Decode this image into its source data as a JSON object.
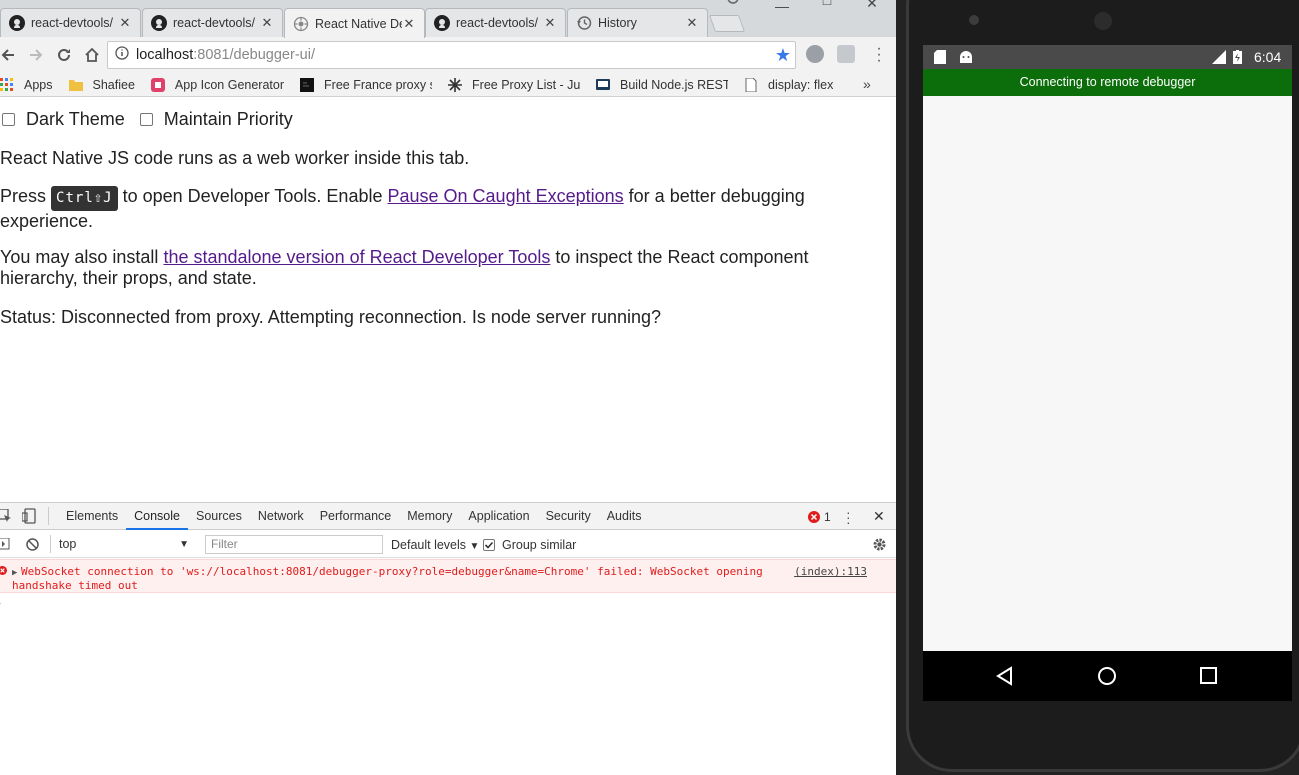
{
  "browser": {
    "tabs": [
      {
        "title": "react-devtools/",
        "icon": "github-icon"
      },
      {
        "title": "react-devtools/",
        "icon": "github-icon"
      },
      {
        "title": "React Native De",
        "icon": "react-native-icon"
      },
      {
        "title": "react-devtools/",
        "icon": "github-icon"
      },
      {
        "title": "History",
        "icon": "history-icon"
      }
    ],
    "active_tab": 2,
    "close_glyph": "✕",
    "url_host": "localhost",
    "url_path": ":8081/debugger-ui/",
    "bookmarks": [
      {
        "label": "Apps",
        "icon": "apps-grid-icon"
      },
      {
        "label": "Shafiee",
        "icon": "folder-icon"
      },
      {
        "label": "App Icon Generator",
        "icon": "app-icon-generator-icon"
      },
      {
        "label": "Free France proxy se",
        "icon": "terminal-icon"
      },
      {
        "label": "Free Proxy List - Just",
        "icon": "proxy-list-icon"
      },
      {
        "label": "Build Node.js RESTfu",
        "icon": "codementor-icon"
      },
      {
        "label": "display: flex",
        "icon": "page-icon"
      }
    ],
    "bookmarks_more": "»"
  },
  "page": {
    "dark_theme_label": "Dark Theme",
    "maintain_priority_label": "Maintain Priority",
    "intro": "React Native JS code runs as a web worker inside this tab.",
    "press_prefix": "Press",
    "shortcut": "Ctrl⇧J",
    "press_middle": "to open Developer Tools. Enable",
    "pause_link": "Pause On Caught Exceptions",
    "press_suffix": "for a better debugging experience.",
    "install_prefix": "You may also install",
    "standalone_link": "the standalone version of React Developer Tools",
    "install_suffix": "to inspect the React component hierarchy, their props, and state.",
    "status": "Status: Disconnected from proxy. Attempting reconnection. Is node server running?"
  },
  "devtools": {
    "tabs": [
      "Elements",
      "Console",
      "Sources",
      "Network",
      "Performance",
      "Memory",
      "Application",
      "Security",
      "Audits"
    ],
    "active_tab": "Console",
    "error_count": "1",
    "context": "top",
    "filter_placeholder": "Filter",
    "levels": "Default levels",
    "group_similar": "Group similar",
    "error_line1": "WebSocket connection to 'ws://localhost:8081/debugger-proxy?role=debugger&name=Chrome' failed: WebSocket opening",
    "error_line2": "handshake timed out",
    "error_source": "(index):113"
  },
  "phone": {
    "time": "6:04",
    "banner": "Connecting to remote debugger",
    "banner_color": "#0b6e0b"
  },
  "colors": {
    "link": "#551a8b",
    "accent": "#1a73e8",
    "error": "#e01b1b"
  }
}
